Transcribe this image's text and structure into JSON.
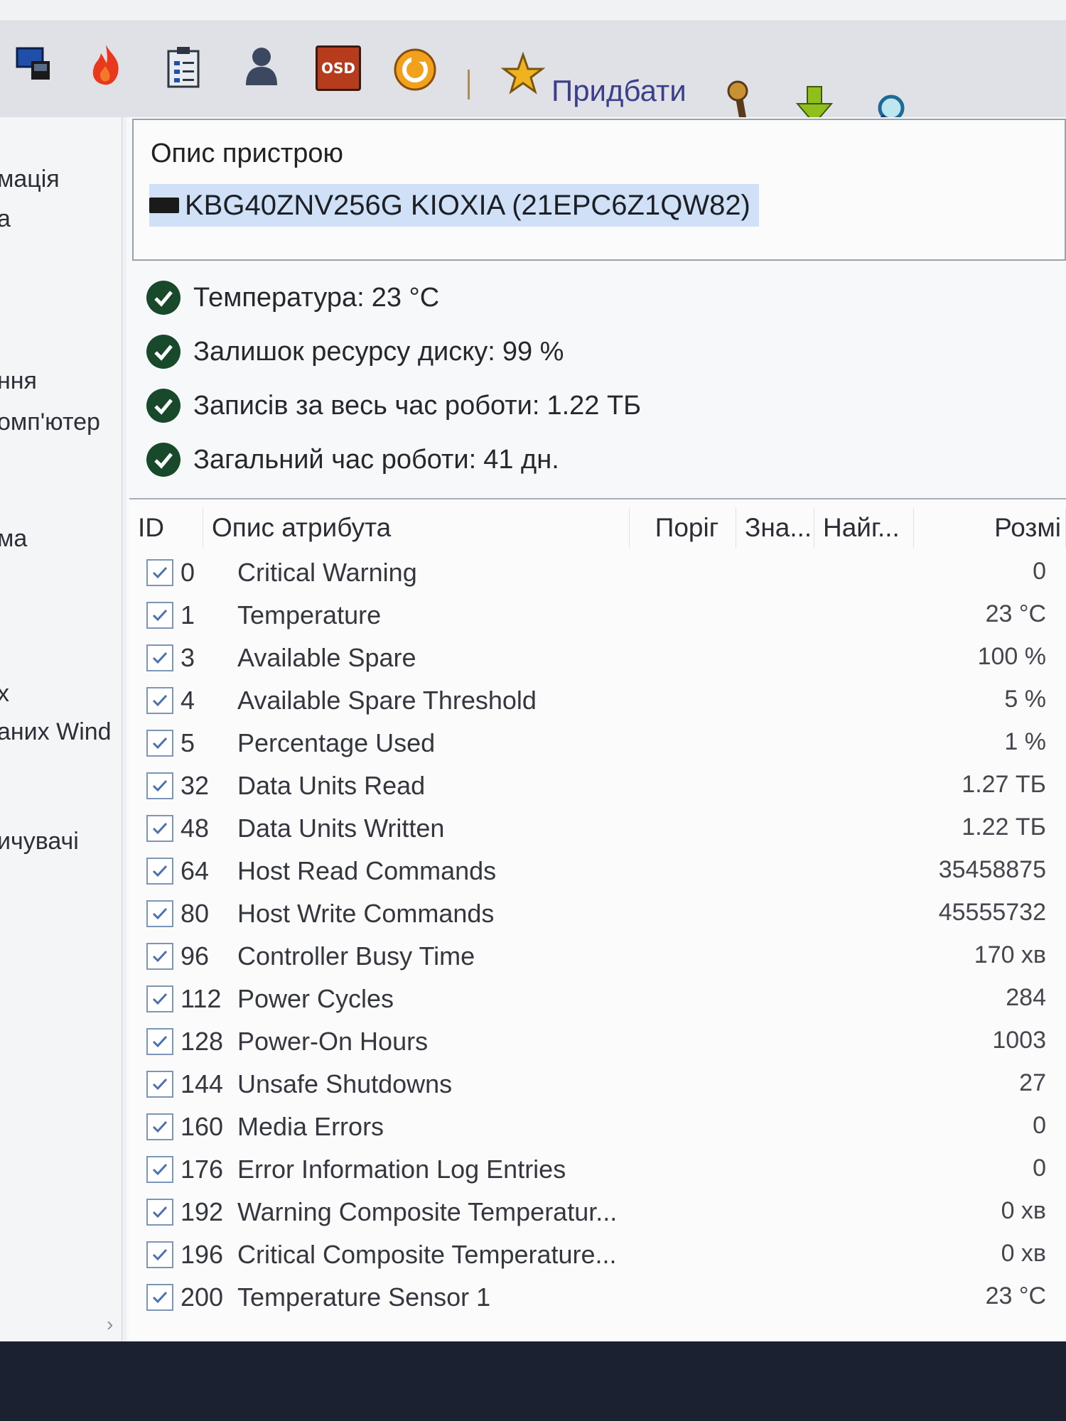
{
  "toolbar": {
    "buy_label": "Придбати",
    "icons": [
      "monitor-icon",
      "fire-icon",
      "clipboard-icon",
      "user-icon",
      "osd-icon",
      "refresh-icon",
      "star-icon",
      "tools-icon",
      "download-icon",
      "search-icon"
    ],
    "osd_text": "OSD"
  },
  "sidebar": {
    "items": [
      {
        "label": "мація"
      },
      {
        "label": "а"
      },
      {
        "label": "ння"
      },
      {
        "label": "омп'ютер"
      },
      {
        "label": "ма"
      },
      {
        "label": "х"
      },
      {
        "label": "аних Wind"
      },
      {
        "label": "ичувачі"
      }
    ],
    "scroll_arrow": "›"
  },
  "device": {
    "section_title": "Опис пристрою",
    "name": "KBG40ZNV256G KIOXIA (21EPC6Z1QW82)"
  },
  "status": [
    {
      "label": "Температура:",
      "value": "23 °C"
    },
    {
      "label": "Залишок ресурсу диску:",
      "value": "99 %"
    },
    {
      "label": "Записів за весь час роботи:",
      "value": "1.22 ТБ"
    },
    {
      "label": "Загальний час роботи:",
      "value": "41 дн."
    }
  ],
  "table": {
    "columns": [
      "ID",
      "Опис атрибута",
      "Поріг",
      "Зна...",
      "Найг...",
      "Розмі"
    ],
    "rows": [
      {
        "id": "0",
        "desc": "Critical Warning",
        "size": "0"
      },
      {
        "id": "1",
        "desc": "Temperature",
        "size": "23 °C"
      },
      {
        "id": "3",
        "desc": "Available Spare",
        "size": "100 %"
      },
      {
        "id": "4",
        "desc": "Available Spare Threshold",
        "size": "5 %"
      },
      {
        "id": "5",
        "desc": "Percentage Used",
        "size": "1 %"
      },
      {
        "id": "32",
        "desc": "Data Units Read",
        "size": "1.27 ТБ"
      },
      {
        "id": "48",
        "desc": "Data Units Written",
        "size": "1.22 ТБ"
      },
      {
        "id": "64",
        "desc": "Host Read Commands",
        "size": "35458875"
      },
      {
        "id": "80",
        "desc": "Host Write Commands",
        "size": "45555732"
      },
      {
        "id": "96",
        "desc": "Controller Busy Time",
        "size": "170 хв"
      },
      {
        "id": "112",
        "desc": "Power Cycles",
        "size": "284"
      },
      {
        "id": "128",
        "desc": "Power-On Hours",
        "size": "1003"
      },
      {
        "id": "144",
        "desc": "Unsafe Shutdowns",
        "size": "27"
      },
      {
        "id": "160",
        "desc": "Media Errors",
        "size": "0"
      },
      {
        "id": "176",
        "desc": "Error Information Log Entries",
        "size": "0"
      },
      {
        "id": "192",
        "desc": "Warning Composite Temperatur...",
        "size": "0 хв"
      },
      {
        "id": "196",
        "desc": "Critical Composite Temperature...",
        "size": "0 хв"
      },
      {
        "id": "200",
        "desc": "Temperature Sensor 1",
        "size": "23 °C"
      }
    ]
  }
}
